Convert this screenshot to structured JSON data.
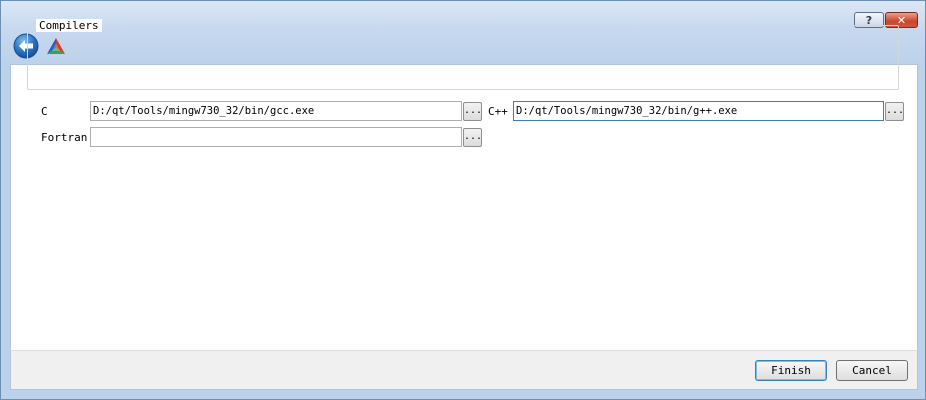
{
  "titlebar": {
    "help_label": "?",
    "close_label": "✕"
  },
  "header": {
    "back_icon": "back-arrow-icon",
    "app_icon": "cmake-logo-icon"
  },
  "compilers": {
    "group_title": "Compilers",
    "c_label": "C",
    "c_value": "D:/qt/Tools/mingw730_32/bin/gcc.exe",
    "cpp_label": "C++",
    "cpp_value": "D:/qt/Tools/mingw730_32/bin/g++.exe",
    "fortran_label": "Fortran",
    "fortran_value": "",
    "browse_label": "..."
  },
  "footer": {
    "finish_label": "Finish",
    "cancel_label": "Cancel"
  },
  "colors": {
    "titlebar_top": "#dbe7f5",
    "titlebar_bottom": "#bcd1ea",
    "focus_border": "#3c7fb1",
    "close_red": "#c8462e"
  }
}
